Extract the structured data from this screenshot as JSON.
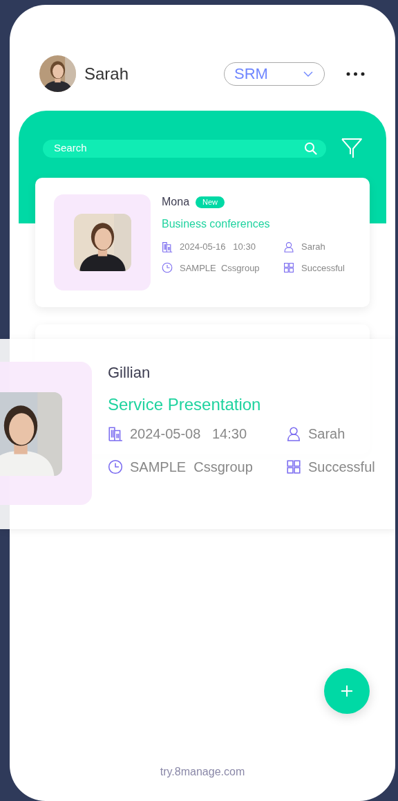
{
  "header": {
    "user_name": "Sarah",
    "module": "SRM"
  },
  "search": {
    "placeholder": "Search"
  },
  "records": [
    {
      "name": "Mona",
      "badge": "New",
      "title": "Business conferences",
      "datetime": "2024-05-16   10:30",
      "owner": "Sarah",
      "company": "SAMPLE  Cssgroup",
      "status": "Successful"
    }
  ],
  "expanded_record": {
    "name": "Gillian",
    "title": "Service Presentation",
    "datetime": "2024-05-08   14:30",
    "owner": "Sarah",
    "company": "SAMPLE  Cssgroup",
    "status": "Successful"
  },
  "footer": "try.8manage.com"
}
